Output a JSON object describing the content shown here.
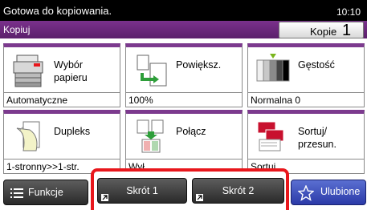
{
  "status": {
    "message": "Gotowa do kopiowania.",
    "time": "10:10"
  },
  "header": {
    "title": "Kopiuj",
    "copies_label": "Kopie",
    "copies_value": "1"
  },
  "tiles": [
    {
      "label": "Wybór\npapieru",
      "value": "Automatyczne",
      "icon": "paper-selection-icon"
    },
    {
      "label": "Powiększ.",
      "value": "100%",
      "icon": "zoom-icon"
    },
    {
      "label": "Gęstość",
      "value": "Normalna 0",
      "icon": "density-icon"
    },
    {
      "label": "Dupleks",
      "value": "1-stronny>>1-str.",
      "icon": "duplex-icon"
    },
    {
      "label": "Połącz",
      "value": "Wył.",
      "icon": "combine-icon"
    },
    {
      "label": "Sortuj/\nprzesun.",
      "value": "Sortuj",
      "icon": "collate-offset-icon"
    }
  ],
  "bottom": {
    "functions_label": "Funkcje",
    "shortcut1_label": "Skrót 1",
    "shortcut2_label": "Skrót 2",
    "favorites_label": "Ulubione"
  },
  "colors": {
    "accent": "#7c3a8e",
    "highlight": "#e8171c",
    "favorites": "#3444b5"
  }
}
